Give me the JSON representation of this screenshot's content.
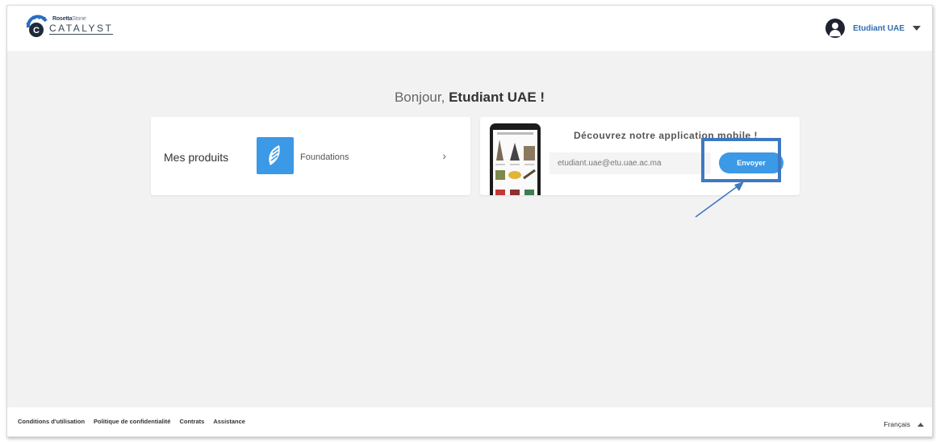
{
  "logo": {
    "brand": "Rosetta",
    "brand_suffix": "Stone",
    "name": "CATALYST"
  },
  "header": {
    "user_name": "Etudiant UAE"
  },
  "greeting": {
    "prefix": "Bonjour,",
    "name": "Etudiant UAE !"
  },
  "products": {
    "title": "Mes produits",
    "product_name": "Foundations"
  },
  "mobile_app": {
    "title": "Découvrez notre application mobile !",
    "email_value": "etudiant.uae@etu.uae.ac.ma",
    "send_label": "Envoyer"
  },
  "footer": {
    "links": [
      "Conditions d'utilisation",
      "Politique de confidentialité",
      "Contrats",
      "Assistance"
    ],
    "language": "Français"
  },
  "colors": {
    "accent": "#3b99e6",
    "highlight": "#3f78c1",
    "user_link": "#2f6dad",
    "background": "#f2f2f2"
  }
}
